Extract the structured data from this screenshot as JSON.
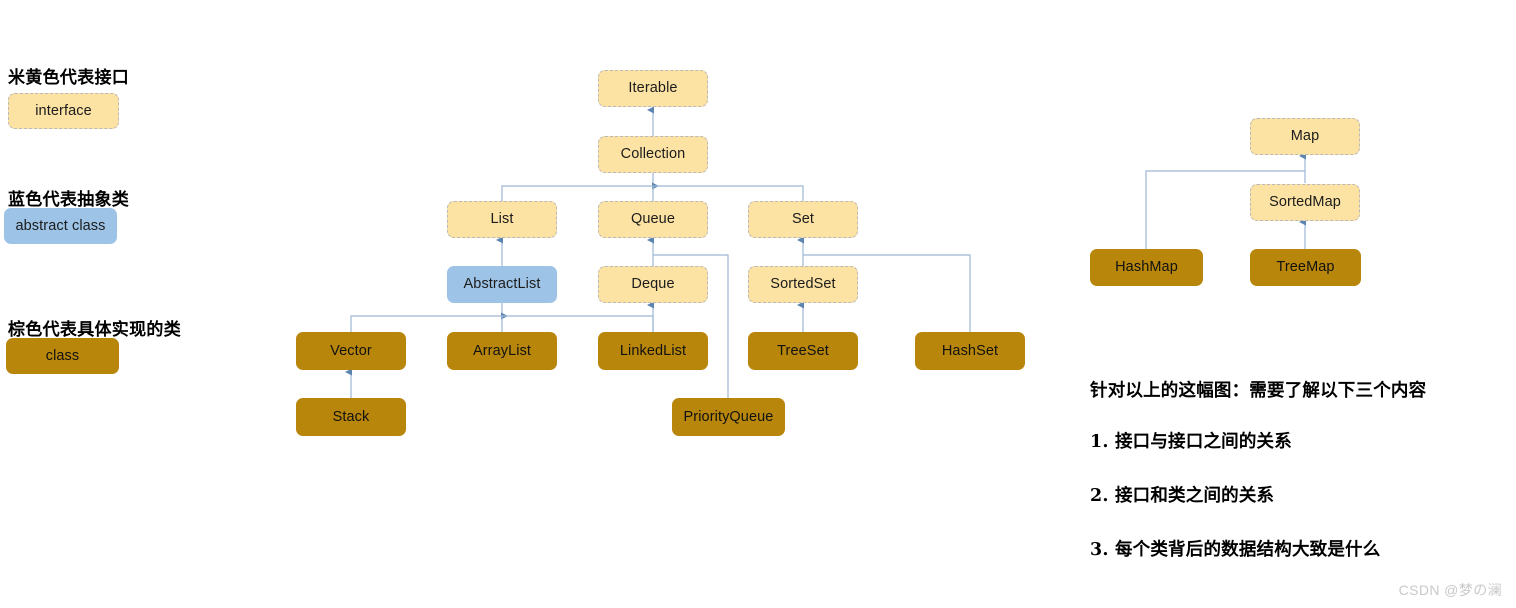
{
  "legend": {
    "items": [
      {
        "title": "米黄色代表接口",
        "sample_label": "interface",
        "kind": "interface",
        "color": "#FCE2A3"
      },
      {
        "title": "蓝色代表抽象类",
        "sample_label": "abstract class",
        "kind": "abstract",
        "color": "#9DC3E6"
      },
      {
        "title": "棕色代表具体实现的类",
        "sample_label": "class",
        "kind": "class",
        "color": "#B8860B"
      }
    ]
  },
  "diagram": {
    "collection_hierarchy": {
      "nodes": [
        {
          "id": "iterable",
          "label": "Iterable",
          "kind": "interface"
        },
        {
          "id": "collection",
          "label": "Collection",
          "kind": "interface"
        },
        {
          "id": "list",
          "label": "List",
          "kind": "interface"
        },
        {
          "id": "queue",
          "label": "Queue",
          "kind": "interface"
        },
        {
          "id": "set",
          "label": "Set",
          "kind": "interface"
        },
        {
          "id": "abstractlist",
          "label": "AbstractList",
          "kind": "abstract"
        },
        {
          "id": "deque",
          "label": "Deque",
          "kind": "interface"
        },
        {
          "id": "sortedset",
          "label": "SortedSet",
          "kind": "interface"
        },
        {
          "id": "vector",
          "label": "Vector",
          "kind": "class"
        },
        {
          "id": "arraylist",
          "label": "ArrayList",
          "kind": "class"
        },
        {
          "id": "linkedlist",
          "label": "LinkedList",
          "kind": "class"
        },
        {
          "id": "treeset",
          "label": "TreeSet",
          "kind": "class"
        },
        {
          "id": "hashset",
          "label": "HashSet",
          "kind": "class"
        },
        {
          "id": "stack",
          "label": "Stack",
          "kind": "class"
        },
        {
          "id": "priorityqueue",
          "label": "PriorityQueue",
          "kind": "class"
        }
      ],
      "edges": [
        {
          "from": "collection",
          "to": "iterable"
        },
        {
          "from": "list",
          "to": "collection"
        },
        {
          "from": "queue",
          "to": "collection"
        },
        {
          "from": "set",
          "to": "collection"
        },
        {
          "from": "abstractlist",
          "to": "list"
        },
        {
          "from": "deque",
          "to": "queue"
        },
        {
          "from": "sortedset",
          "to": "set"
        },
        {
          "from": "vector",
          "to": "abstractlist"
        },
        {
          "from": "arraylist",
          "to": "abstractlist"
        },
        {
          "from": "linkedlist",
          "to": "abstractlist"
        },
        {
          "from": "linkedlist",
          "to": "deque"
        },
        {
          "from": "treeset",
          "to": "sortedset"
        },
        {
          "from": "hashset",
          "to": "set"
        },
        {
          "from": "stack",
          "to": "vector"
        },
        {
          "from": "priorityqueue",
          "to": "queue"
        }
      ]
    },
    "map_hierarchy": {
      "nodes": [
        {
          "id": "map",
          "label": "Map",
          "kind": "interface"
        },
        {
          "id": "sortedmap",
          "label": "SortedMap",
          "kind": "interface"
        },
        {
          "id": "hashmap",
          "label": "HashMap",
          "kind": "class"
        },
        {
          "id": "treemap",
          "label": "TreeMap",
          "kind": "class"
        }
      ],
      "edges": [
        {
          "from": "sortedmap",
          "to": "map"
        },
        {
          "from": "hashmap",
          "to": "map"
        },
        {
          "from": "treemap",
          "to": "sortedmap"
        }
      ]
    }
  },
  "notes": {
    "heading": "针对以上的这幅图：需要了解以下三个内容",
    "items": [
      "1. 接口与接口之间的关系",
      "2. 接口和类之间的关系",
      "3. 每个类背后的数据结构大致是什么"
    ]
  },
  "watermark": "CSDN @梦の澜",
  "colors": {
    "interface_fill": "#FCE2A3",
    "interface_border": "#B9B9B9",
    "abstract_fill": "#9DC3E6",
    "class_fill": "#B8860B",
    "connector": "#9DB7D4",
    "background": "#FFFFFF"
  }
}
